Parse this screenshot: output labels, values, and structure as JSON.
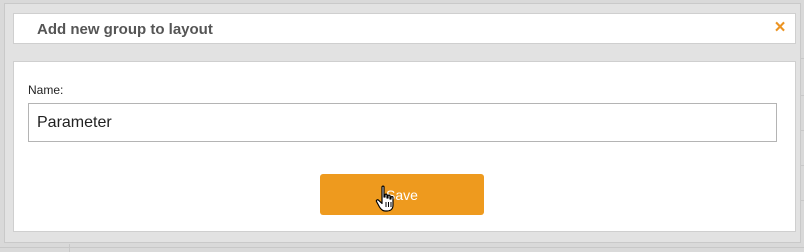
{
  "dialog": {
    "title": "Add new group to layout",
    "close_symbol": "×",
    "name_label": "Name:",
    "name_value": "Parameter",
    "save_label": "Save"
  },
  "colors": {
    "accent": "#ee9a1e",
    "close": "#ec9422",
    "title_text": "#555555"
  },
  "icons": {
    "close": "close-icon",
    "cursor": "hand-pointer-icon"
  }
}
